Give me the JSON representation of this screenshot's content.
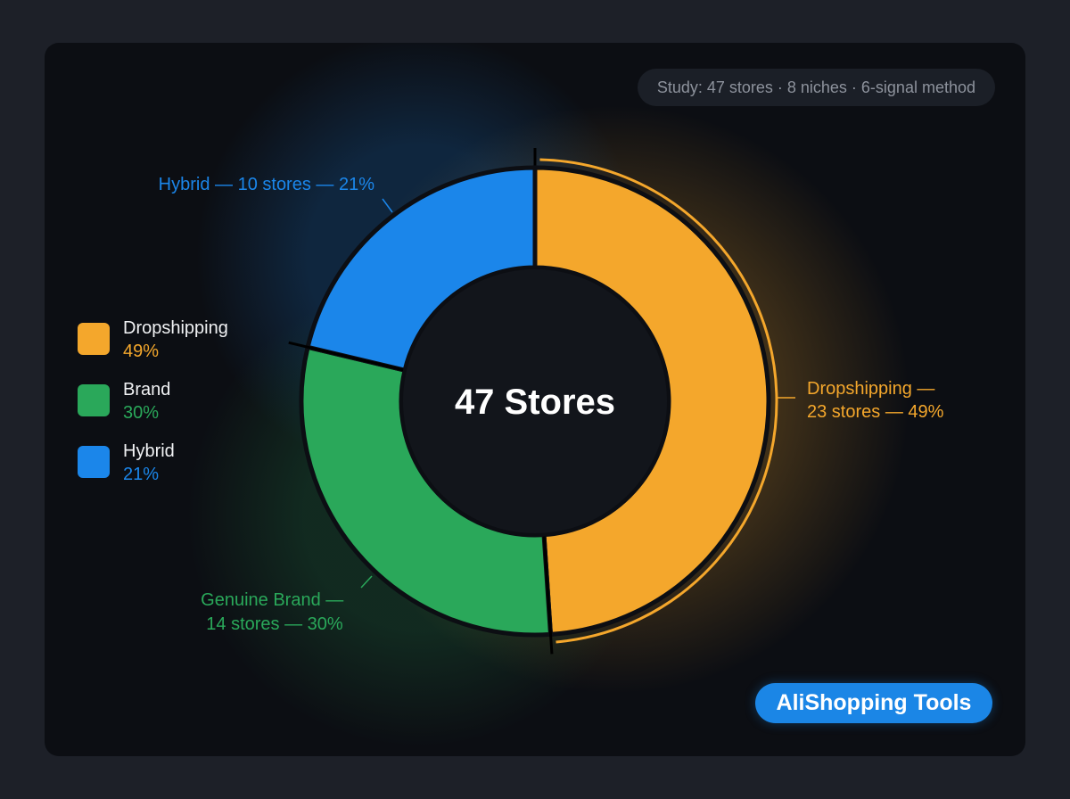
{
  "study_badge": "Study: 47 stores · 8 niches · 6-signal method",
  "brand_label": "AliShopping Tools",
  "colors": {
    "dropshipping": "#f4a72c",
    "brand": "#2aa85a",
    "hybrid": "#1b86ea",
    "background": "#0c0e13"
  },
  "legend": [
    {
      "name": "Dropshipping",
      "pct": "49%"
    },
    {
      "name": "Brand",
      "pct": "30%"
    },
    {
      "name": "Hybrid",
      "pct": "21%"
    }
  ],
  "callouts": {
    "dropshipping": [
      "Dropshipping —",
      "23 stores — 49%"
    ],
    "brand": [
      "Genuine Brand —",
      "14 stores — 30%"
    ],
    "hybrid": [
      "Hybrid — 10 stores — 21%"
    ]
  },
  "chart_data": {
    "type": "pie",
    "donut": true,
    "center_label": "47 Stores",
    "categories": [
      "Dropshipping",
      "Brand",
      "Hybrid"
    ],
    "values": [
      23,
      14,
      10
    ],
    "percentages": [
      49,
      30,
      21
    ],
    "total": 47
  }
}
